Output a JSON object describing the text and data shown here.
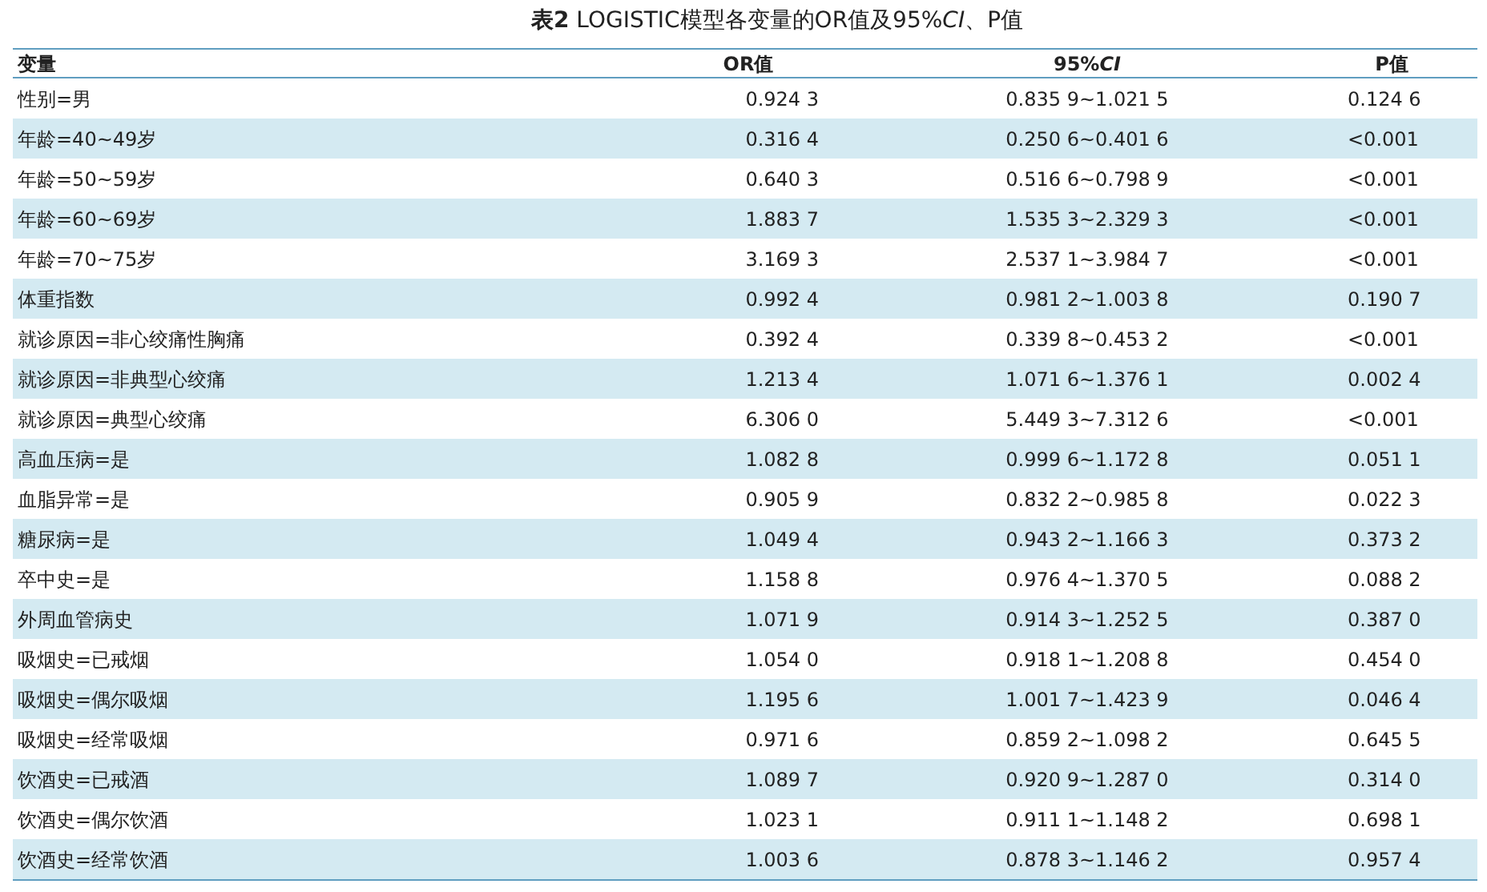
{
  "title": "**表2** LOGISTIC模型各变量的OR值及95%*CI*、P值",
  "table": {
    "columns": [
      "变量",
      "OR值",
      "95%*CI*",
      "P值"
    ],
    "rows": [
      [
        "性别=男",
        "0.924 3",
        "0.835 9~1.021 5",
        "0.124 6"
      ],
      [
        "年龄=40~49岁",
        "0.316 4",
        "0.250 6~0.401 6",
        "<0.001"
      ],
      [
        "年龄=50~59岁",
        "0.640 3",
        "0.516 6~0.798 9",
        "<0.001"
      ],
      [
        "年龄=60~69岁",
        "1.883 7",
        "1.535 3~2.329 3",
        "<0.001"
      ],
      [
        "年龄=70~75岁",
        "3.169 3",
        "2.537 1~3.984 7",
        "<0.001"
      ],
      [
        "体重指数",
        "0.992 4",
        "0.981 2~1.003 8",
        "0.190 7"
      ],
      [
        "就诊原因=非心绞痛性胸痛",
        "0.392 4",
        "0.339 8~0.453 2",
        "<0.001"
      ],
      [
        "就诊原因=非典型心绞痛",
        "1.213 4",
        "1.071 6~1.376 1",
        "0.002 4"
      ],
      [
        "就诊原因=典型心绞痛",
        "6.306 0",
        "5.449 3~7.312 6",
        "<0.001"
      ],
      [
        "高血压病=是",
        "1.082 8",
        "0.999 6~1.172 8",
        "0.051 1"
      ],
      [
        "血脂异常=是",
        "0.905 9",
        "0.832 2~0.985 8",
        "0.022 3"
      ],
      [
        "糖尿病=是",
        "1.049 4",
        "0.943 2~1.166 3",
        "0.373 2"
      ],
      [
        "卒中史=是",
        "1.158 8",
        "0.976 4~1.370 5",
        "0.088 2"
      ],
      [
        "外周血管病史",
        "1.071 9",
        "0.914 3~1.252 5",
        "0.387 0"
      ],
      [
        "吸烟史=已戒烟",
        "1.054 0",
        "0.918 1~1.208 8",
        "0.454 0"
      ],
      [
        "吸烟史=偶尔吸烟",
        "1.195 6",
        "1.001 7~1.423 9",
        "0.046 4"
      ],
      [
        "吸烟史=经常吸烟",
        "0.971 6",
        "0.859 2~1.098 2",
        "0.645 5"
      ],
      [
        "饮酒史=已戒酒",
        "1.089 7",
        "0.920 9~1.287 0",
        "0.314 0"
      ],
      [
        "饮酒史=偶尔饮酒",
        "1.023 1",
        "0.911 1~1.148 2",
        "0.698 1"
      ],
      [
        "饮酒史=经常饮酒",
        "1.003 6",
        "0.878 3~1.146 2",
        "0.957 4"
      ]
    ]
  }
}
